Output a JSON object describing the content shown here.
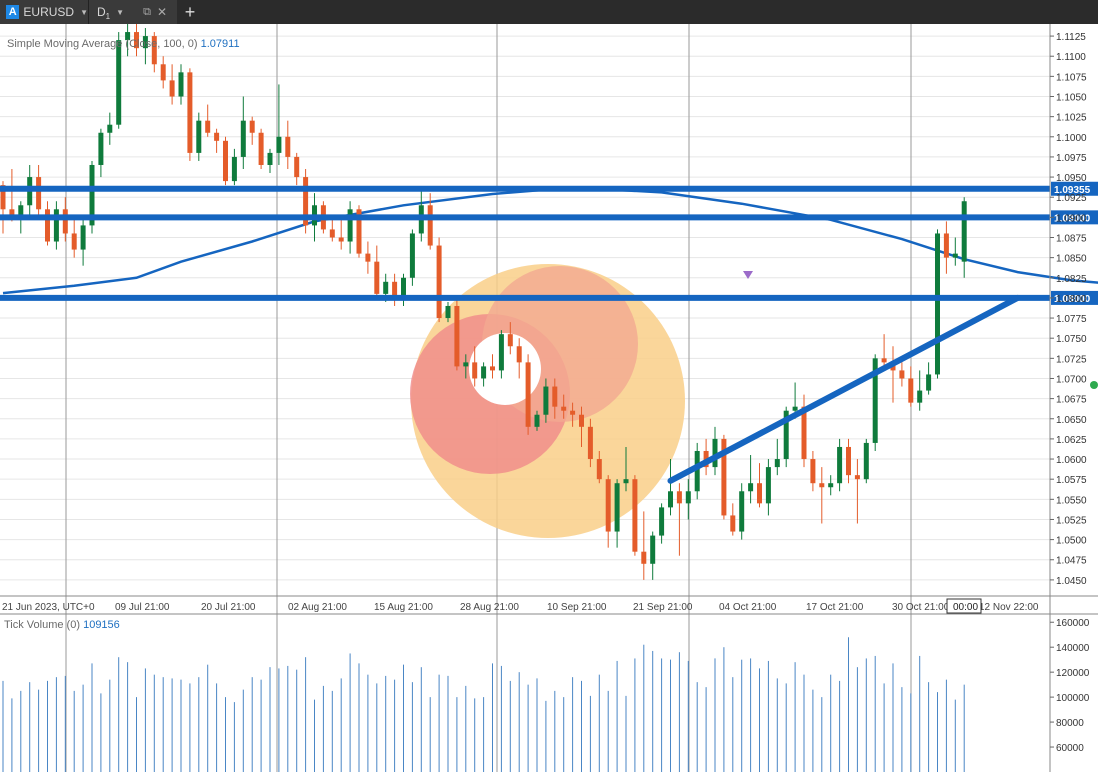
{
  "tabs": {
    "symbol_icon": "A",
    "symbol": "EURUSD",
    "timeframe_letter": "D",
    "timeframe_sub": "1"
  },
  "indicators": {
    "sma_label": "Simple Moving Average (Close, 100, 0)",
    "sma_value": "1.07911",
    "volume_label": "Tick Volume (0)",
    "volume_value": "109156"
  },
  "colors": {
    "bull": "#0f7b3c",
    "bear": "#e45c2a",
    "line": "#1565c0",
    "sma": "#1565c0",
    "grid": "#e6e6e6",
    "volume": "#4a86c5"
  },
  "chart_data": {
    "type": "candlestick",
    "price_ylim": [
      1.043,
      1.114
    ],
    "price_ticks": [
      "1.1125",
      "1.1100",
      "1.1075",
      "1.1050",
      "1.1025",
      "1.1000",
      "1.0975",
      "1.0950",
      "1.0925",
      "1.0900",
      "1.0875",
      "1.0850",
      "1.0825",
      "1.0800",
      "1.0775",
      "1.0750",
      "1.0725",
      "1.0700",
      "1.0675",
      "1.0650",
      "1.0625",
      "1.0600",
      "1.0575",
      "1.0550",
      "1.0525",
      "1.0500",
      "1.0475",
      "1.0450"
    ],
    "date_labels": [
      "21 Jun 2023, UTC+0",
      "09 Jul 21:00",
      "20 Jul 21:00",
      "02 Aug 21:00",
      "15 Aug 21:00",
      "28 Aug 21:00",
      "10 Sep 21:00",
      "21 Sep 21:00",
      "04 Oct 21:00",
      "17 Oct 21:00",
      "30 Oct 21:00",
      "12 Nov 22:00"
    ],
    "horizontal_lines": [
      "1.09355",
      "1.09000",
      "1.08000"
    ],
    "current_time_label": "00:00",
    "trendline": {
      "from": [
        1.0573
      ],
      "to": [
        1.08
      ]
    },
    "candles": [
      [
        1.094,
        1.0945,
        1.088,
        1.091
      ],
      [
        1.091,
        1.096,
        1.0895,
        1.09
      ],
      [
        1.09,
        1.092,
        1.088,
        1.0915
      ],
      [
        1.0915,
        1.0965,
        1.09,
        1.095
      ],
      [
        1.095,
        1.0965,
        1.09,
        1.091
      ],
      [
        1.091,
        1.092,
        1.0865,
        1.087
      ],
      [
        1.087,
        1.092,
        1.086,
        1.091
      ],
      [
        1.091,
        1.0925,
        1.087,
        1.088
      ],
      [
        1.088,
        1.09,
        1.085,
        1.086
      ],
      [
        1.086,
        1.09,
        1.084,
        1.089
      ],
      [
        1.089,
        1.097,
        1.088,
        1.0965
      ],
      [
        1.0965,
        1.101,
        1.095,
        1.1005
      ],
      [
        1.1005,
        1.103,
        1.099,
        1.1015
      ],
      [
        1.1015,
        1.113,
        1.101,
        1.112
      ],
      [
        1.112,
        1.114,
        1.11,
        1.113
      ],
      [
        1.113,
        1.114,
        1.11,
        1.111
      ],
      [
        1.111,
        1.1135,
        1.109,
        1.1125
      ],
      [
        1.1125,
        1.113,
        1.108,
        1.109
      ],
      [
        1.109,
        1.11,
        1.106,
        1.107
      ],
      [
        1.107,
        1.109,
        1.104,
        1.105
      ],
      [
        1.105,
        1.109,
        1.104,
        1.108
      ],
      [
        1.108,
        1.1085,
        1.097,
        1.098
      ],
      [
        1.098,
        1.103,
        1.097,
        1.102
      ],
      [
        1.102,
        1.104,
        1.1,
        1.1005
      ],
      [
        1.1005,
        1.101,
        1.098,
        1.0995
      ],
      [
        1.0995,
        1.1,
        1.094,
        1.0945
      ],
      [
        1.0945,
        1.0985,
        1.094,
        1.0975
      ],
      [
        1.0975,
        1.105,
        1.096,
        1.102
      ],
      [
        1.102,
        1.1025,
        1.099,
        1.1005
      ],
      [
        1.1005,
        1.101,
        1.096,
        1.0965
      ],
      [
        1.0965,
        1.0985,
        1.0955,
        1.098
      ],
      [
        1.098,
        1.1065,
        1.0965,
        1.1
      ],
      [
        1.1,
        1.102,
        1.096,
        1.0975
      ],
      [
        1.0975,
        1.098,
        1.094,
        1.095
      ],
      [
        1.095,
        1.096,
        1.088,
        1.089
      ],
      [
        1.089,
        1.093,
        1.087,
        1.0915
      ],
      [
        1.0915,
        1.092,
        1.088,
        1.0885
      ],
      [
        1.0885,
        1.09,
        1.087,
        1.0875
      ],
      [
        1.0875,
        1.09,
        1.086,
        1.087
      ],
      [
        1.087,
        1.092,
        1.0855,
        1.091
      ],
      [
        1.091,
        1.0915,
        1.085,
        1.0855
      ],
      [
        1.0855,
        1.087,
        1.083,
        1.0845
      ],
      [
        1.0845,
        1.0865,
        1.08,
        1.0805
      ],
      [
        1.0805,
        1.083,
        1.0795,
        1.082
      ],
      [
        1.082,
        1.083,
        1.079,
        1.08
      ],
      [
        1.08,
        1.083,
        1.079,
        1.0825
      ],
      [
        1.0825,
        1.0885,
        1.0815,
        1.088
      ],
      [
        1.088,
        1.0935,
        1.087,
        1.0915
      ],
      [
        1.0915,
        1.093,
        1.086,
        1.0865
      ],
      [
        1.0865,
        1.0875,
        1.077,
        1.0775
      ],
      [
        1.0775,
        1.0795,
        1.077,
        1.079
      ],
      [
        1.079,
        1.08,
        1.071,
        1.0715
      ],
      [
        1.0715,
        1.073,
        1.07,
        1.072
      ],
      [
        1.072,
        1.074,
        1.069,
        1.07
      ],
      [
        1.07,
        1.072,
        1.069,
        1.0715
      ],
      [
        1.0715,
        1.073,
        1.07,
        1.071
      ],
      [
        1.071,
        1.076,
        1.07,
        1.0755
      ],
      [
        1.0755,
        1.077,
        1.073,
        1.074
      ],
      [
        1.074,
        1.075,
        1.07,
        1.072
      ],
      [
        1.072,
        1.073,
        1.063,
        1.064
      ],
      [
        1.064,
        1.066,
        1.0635,
        1.0655
      ],
      [
        1.0655,
        1.07,
        1.0645,
        1.069
      ],
      [
        1.069,
        1.07,
        1.065,
        1.0665
      ],
      [
        1.0665,
        1.068,
        1.065,
        1.066
      ],
      [
        1.066,
        1.067,
        1.064,
        1.0655
      ],
      [
        1.0655,
        1.0665,
        1.0615,
        1.064
      ],
      [
        1.064,
        1.065,
        1.059,
        1.06
      ],
      [
        1.06,
        1.061,
        1.057,
        1.0575
      ],
      [
        1.0575,
        1.058,
        1.049,
        1.051
      ],
      [
        1.051,
        1.0575,
        1.049,
        1.057
      ],
      [
        1.057,
        1.0615,
        1.056,
        1.0575
      ],
      [
        1.0575,
        1.058,
        1.048,
        1.0485
      ],
      [
        1.0485,
        1.0535,
        1.045,
        1.047
      ],
      [
        1.047,
        1.051,
        1.045,
        1.0505
      ],
      [
        1.0505,
        1.0545,
        1.0495,
        1.054
      ],
      [
        1.054,
        1.06,
        1.053,
        1.056
      ],
      [
        1.056,
        1.057,
        1.048,
        1.0545
      ],
      [
        1.0545,
        1.0575,
        1.0525,
        1.056
      ],
      [
        1.056,
        1.062,
        1.055,
        1.061
      ],
      [
        1.061,
        1.0625,
        1.058,
        1.059
      ],
      [
        1.059,
        1.064,
        1.058,
        1.0625
      ],
      [
        1.0625,
        1.063,
        1.0525,
        1.053
      ],
      [
        1.053,
        1.0545,
        1.0505,
        1.051
      ],
      [
        1.051,
        1.057,
        1.05,
        1.056
      ],
      [
        1.056,
        1.0605,
        1.0545,
        1.057
      ],
      [
        1.057,
        1.0595,
        1.054,
        1.0545
      ],
      [
        1.0545,
        1.06,
        1.053,
        1.059
      ],
      [
        1.059,
        1.0625,
        1.058,
        1.06
      ],
      [
        1.06,
        1.0665,
        1.059,
        1.066
      ],
      [
        1.066,
        1.0695,
        1.065,
        1.0665
      ],
      [
        1.0665,
        1.068,
        1.059,
        1.06
      ],
      [
        1.06,
        1.061,
        1.056,
        1.057
      ],
      [
        1.057,
        1.059,
        1.052,
        1.0565
      ],
      [
        1.0565,
        1.058,
        1.0555,
        1.057
      ],
      [
        1.057,
        1.0625,
        1.056,
        1.0615
      ],
      [
        1.0615,
        1.0625,
        1.057,
        1.058
      ],
      [
        1.058,
        1.06,
        1.052,
        1.0575
      ],
      [
        1.0575,
        1.0625,
        1.057,
        1.062
      ],
      [
        1.062,
        1.073,
        1.061,
        1.0725
      ],
      [
        1.0725,
        1.0755,
        1.071,
        1.072
      ],
      [
        1.072,
        1.074,
        1.067,
        1.071
      ],
      [
        1.071,
        1.072,
        1.069,
        1.07
      ],
      [
        1.07,
        1.0715,
        1.0665,
        1.067
      ],
      [
        1.067,
        1.071,
        1.066,
        1.0685
      ],
      [
        1.0685,
        1.072,
        1.068,
        1.0705
      ],
      [
        1.0705,
        1.0885,
        1.07,
        1.088
      ],
      [
        1.088,
        1.0895,
        1.083,
        1.085
      ],
      [
        1.085,
        1.0875,
        1.084,
        1.0855
      ],
      [
        1.0845,
        1.0925,
        1.0825,
        1.092
      ]
    ],
    "sma": [
      [
        0,
        1.0806
      ],
      [
        8,
        1.0815
      ],
      [
        15,
        1.0825
      ],
      [
        20,
        1.0845
      ],
      [
        28,
        1.087
      ],
      [
        35,
        1.0895
      ],
      [
        45,
        1.0915
      ],
      [
        55,
        1.0929
      ],
      [
        64,
        1.0937
      ],
      [
        74,
        1.0931
      ],
      [
        83,
        1.0917
      ],
      [
        93,
        1.0897
      ],
      [
        101,
        1.0873
      ],
      [
        108,
        1.0848
      ],
      [
        114,
        1.0832
      ],
      [
        120,
        1.0822
      ],
      [
        128,
        1.0814
      ],
      [
        138,
        1.0807
      ],
      [
        145,
        1.08
      ],
      [
        150,
        1.0797
      ],
      [
        153,
        1.0797
      ]
    ],
    "volume_ylim": [
      40000,
      165000
    ],
    "volume_ticks": [
      "160000",
      "140000",
      "120000",
      "100000",
      "80000",
      "60000"
    ],
    "volumes": [
      113000,
      99000,
      105000,
      112000,
      106000,
      113000,
      116000,
      117000,
      105000,
      110000,
      127000,
      103000,
      114000,
      132000,
      128000,
      100000,
      123000,
      118000,
      116000,
      115000,
      114000,
      111000,
      116000,
      126000,
      111000,
      100000,
      96000,
      106000,
      116000,
      114000,
      124000,
      123000,
      125000,
      122000,
      132000,
      98000,
      109000,
      105000,
      115000,
      135000,
      127000,
      118000,
      111000,
      117000,
      114000,
      126000,
      112000,
      124000,
      100000,
      118000,
      117000,
      100000,
      109000,
      99000,
      100000,
      127000,
      125000,
      113000,
      120000,
      110000,
      115000,
      97000,
      105000,
      100000,
      116000,
      113000,
      101000,
      118000,
      105000,
      129000,
      101000,
      131000,
      142000,
      137000,
      131000,
      130000,
      136000,
      129000,
      112000,
      108000,
      131000,
      140000,
      116000,
      130000,
      131000,
      123000,
      129000,
      115000,
      111000,
      128000,
      118000,
      106000,
      100000,
      118000,
      113000,
      148000,
      124000,
      131000,
      133000,
      111000,
      127000,
      108000,
      103000,
      133000,
      112000,
      104000,
      114000,
      98000,
      110000,
      114000,
      112000,
      111000,
      121000,
      123000,
      104000,
      116000,
      110000,
      115000,
      114000,
      120000,
      112000,
      119000
    ]
  }
}
